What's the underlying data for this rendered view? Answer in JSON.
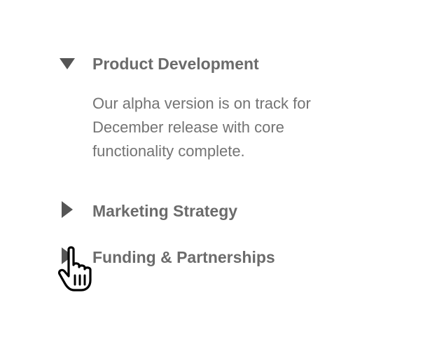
{
  "accordion": {
    "sections": [
      {
        "title": "Product Development",
        "expanded": true,
        "toggle_icon": "triangle-down-icon",
        "body_lines": [
          "Our alpha version is on track for",
          "December release with core",
          "functionality complete."
        ]
      },
      {
        "title": "Marketing Strategy",
        "expanded": false,
        "toggle_icon": "triangle-right-icon"
      },
      {
        "title": "Funding & Partnerships",
        "expanded": false,
        "toggle_icon": "triangle-right-icon"
      }
    ]
  },
  "cursor": {
    "icon": "hand-pointer-icon"
  },
  "colors": {
    "text": "#6b6b6b",
    "icon": "#555555",
    "background": "#ffffff"
  }
}
